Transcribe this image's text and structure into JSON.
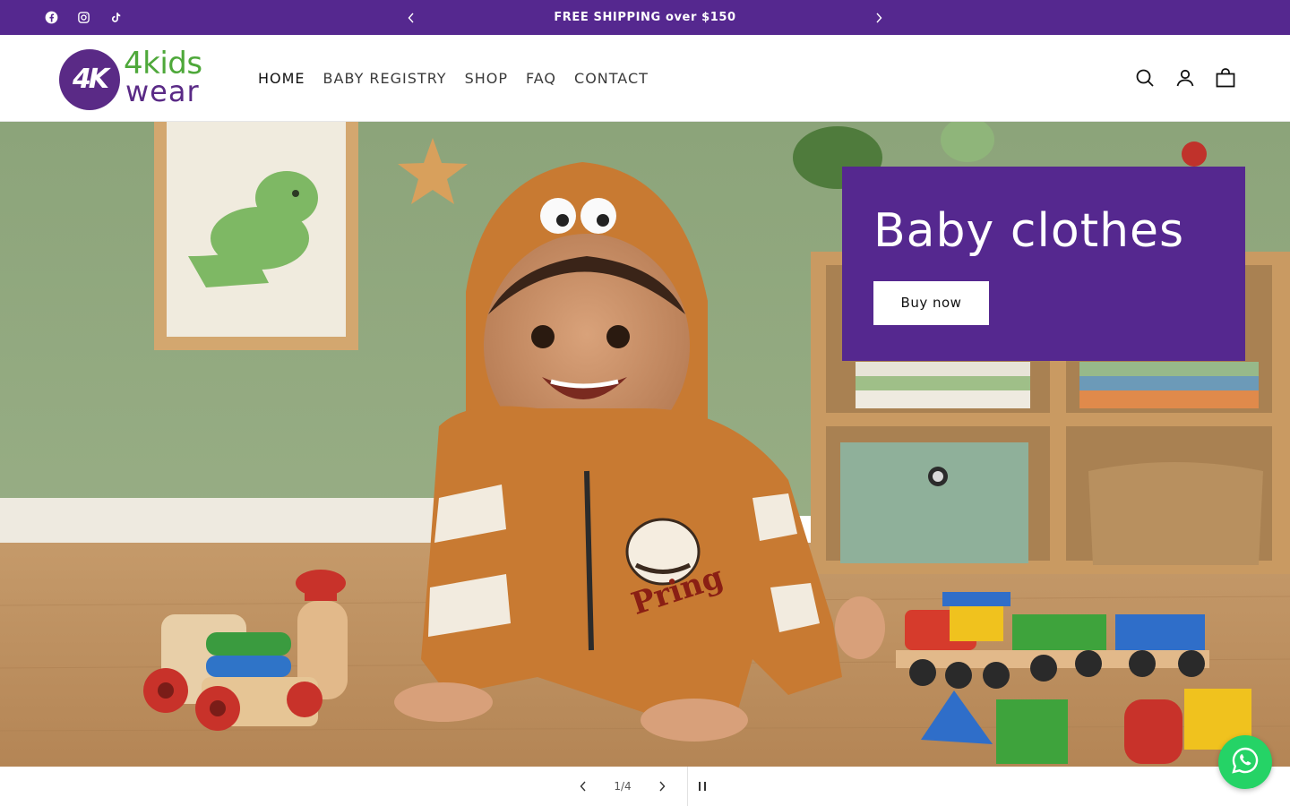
{
  "announcement": {
    "message": "FREE SHIPPING over $150",
    "social_icons": [
      "facebook-icon",
      "instagram-icon",
      "tiktok-icon"
    ],
    "background": "#55288f"
  },
  "header": {
    "logo": {
      "monogram": "4K",
      "line1": "4kids",
      "line2": "wear"
    },
    "nav": [
      {
        "label": "HOME",
        "active": true
      },
      {
        "label": "BABY REGISTRY"
      },
      {
        "label": "SHOP"
      },
      {
        "label": "FAQ"
      },
      {
        "label": "CONTACT"
      }
    ],
    "icons": [
      "search-icon",
      "account-icon",
      "cart-icon"
    ]
  },
  "hero": {
    "heading": "Baby clothes",
    "button_label": "Buy now",
    "promo_color": "#55288f",
    "printed_text_on_image": "Pring"
  },
  "slider": {
    "counter_current": "1",
    "counter_separator": "/",
    "counter_total": "4"
  },
  "colors": {
    "brand_purple": "#55288f",
    "brand_green": "#4ea83a",
    "whatsapp_green": "#25d366"
  }
}
